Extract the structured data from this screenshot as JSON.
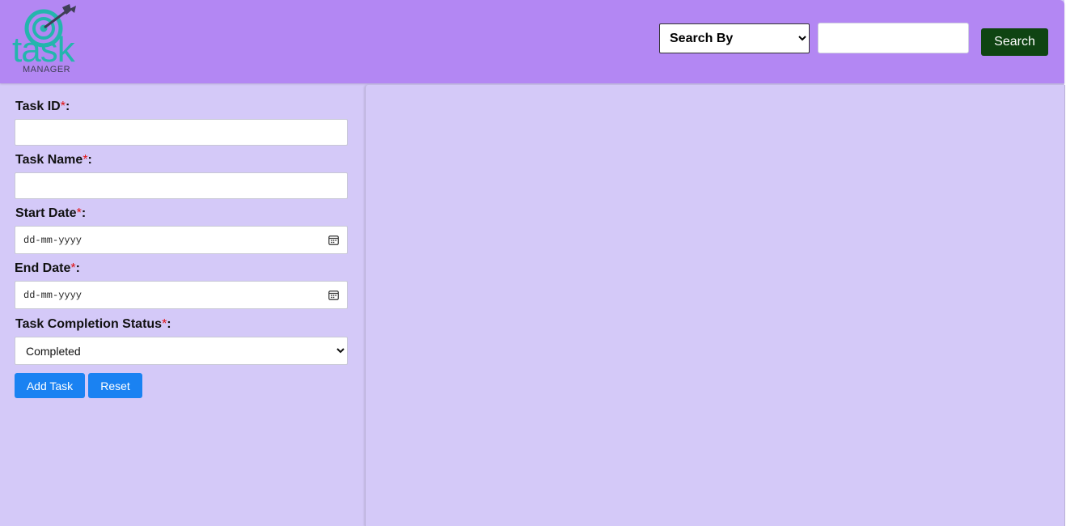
{
  "header": {
    "logo": {
      "word": "task",
      "sub": "MANAGER",
      "accent_color": "#24b5ad"
    },
    "search": {
      "select_value": "Search By",
      "input_value": "",
      "button_label": "Search"
    }
  },
  "form": {
    "required_marker": "*",
    "fields": [
      {
        "label": "Task ID",
        "value": ""
      },
      {
        "label": "Task Name",
        "value": ""
      },
      {
        "label": "Start Date",
        "placeholder": "dd-mm-yyyy"
      },
      {
        "label": "End Date",
        "placeholder": "dd-mm-yyyy"
      },
      {
        "label": "Task Completion Status",
        "selected": "Completed"
      }
    ],
    "buttons": {
      "add": "Add Task",
      "reset": "Reset"
    }
  },
  "colors": {
    "header_bg": "#b387f3",
    "panel_bg": "#d4c9f8",
    "search_button_bg": "#0f4412",
    "primary_button_bg": "#1a82f2",
    "required_color": "#e01010"
  }
}
